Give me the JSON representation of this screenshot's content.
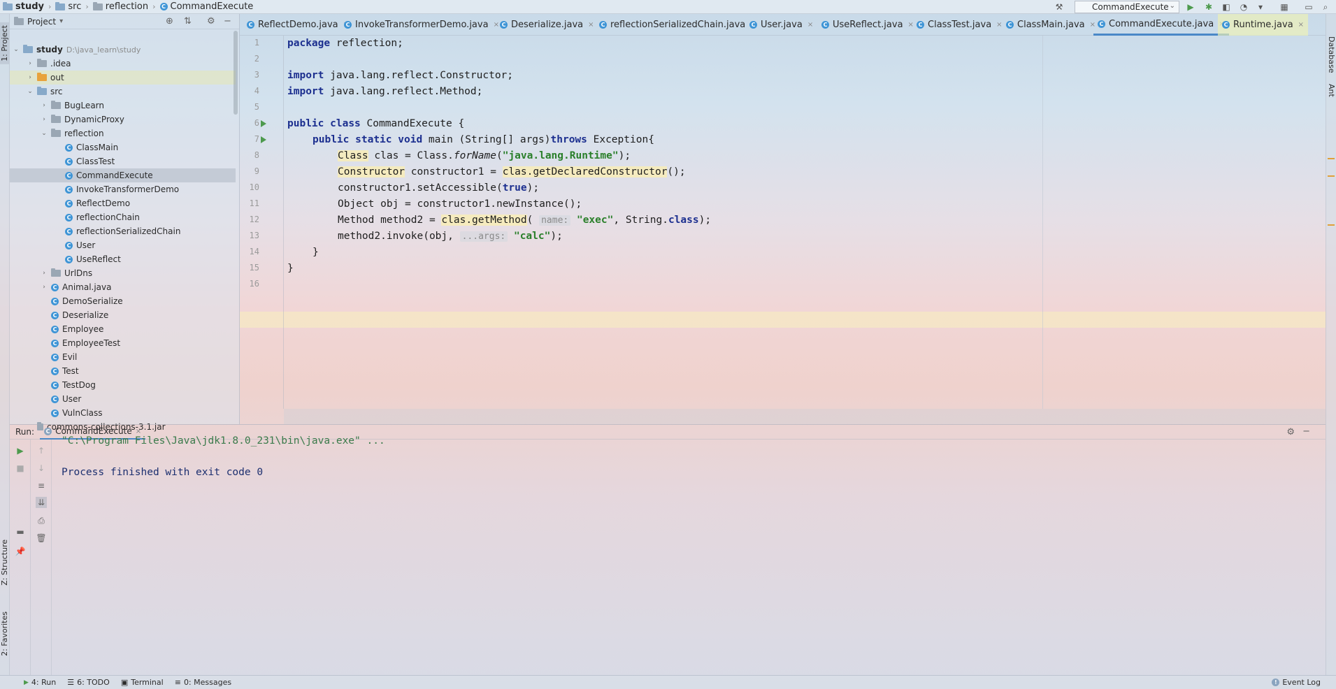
{
  "navbar": {
    "crumbs": [
      "study",
      "src",
      "reflection",
      "CommandExecute"
    ],
    "run_config": "CommandExecute"
  },
  "left_stripe": {
    "tabs": [
      "1: Project",
      "Z: Structure",
      "2: Favorites"
    ]
  },
  "project": {
    "header": "Project",
    "tree": [
      {
        "label": "study",
        "extra": "D:\\java_learn\\study",
        "depth": 0,
        "type": "module",
        "arrow": "down"
      },
      {
        "label": ".idea",
        "depth": 1,
        "type": "folder",
        "arrow": "right"
      },
      {
        "label": "out",
        "depth": 1,
        "type": "folder-orange",
        "arrow": "right",
        "highlight": true
      },
      {
        "label": "src",
        "depth": 1,
        "type": "folder-blue",
        "arrow": "down"
      },
      {
        "label": "BugLearn",
        "depth": 2,
        "type": "folder",
        "arrow": "right"
      },
      {
        "label": "DynamicProxy",
        "depth": 2,
        "type": "folder",
        "arrow": "right"
      },
      {
        "label": "reflection",
        "depth": 2,
        "type": "folder",
        "arrow": "down"
      },
      {
        "label": "ClassMain",
        "depth": 3,
        "type": "class"
      },
      {
        "label": "ClassTest",
        "depth": 3,
        "type": "class"
      },
      {
        "label": "CommandExecute",
        "depth": 3,
        "type": "class",
        "selected": true
      },
      {
        "label": "InvokeTransformerDemo",
        "depth": 3,
        "type": "class"
      },
      {
        "label": "ReflectDemo",
        "depth": 3,
        "type": "class"
      },
      {
        "label": "reflectionChain",
        "depth": 3,
        "type": "class"
      },
      {
        "label": "reflectionSerializedChain",
        "depth": 3,
        "type": "class"
      },
      {
        "label": "User",
        "depth": 3,
        "type": "class"
      },
      {
        "label": "UseReflect",
        "depth": 3,
        "type": "class"
      },
      {
        "label": "UrlDns",
        "depth": 2,
        "type": "folder",
        "arrow": "right"
      },
      {
        "label": "Animal.java",
        "depth": 2,
        "type": "class",
        "arrow": "right"
      },
      {
        "label": "DemoSerialize",
        "depth": 2,
        "type": "class"
      },
      {
        "label": "Deserialize",
        "depth": 2,
        "type": "class"
      },
      {
        "label": "Employee",
        "depth": 2,
        "type": "class"
      },
      {
        "label": "EmployeeTest",
        "depth": 2,
        "type": "class"
      },
      {
        "label": "Evil",
        "depth": 2,
        "type": "class"
      },
      {
        "label": "Test",
        "depth": 2,
        "type": "class"
      },
      {
        "label": "TestDog",
        "depth": 2,
        "type": "class"
      },
      {
        "label": "User",
        "depth": 2,
        "type": "class"
      },
      {
        "label": "VulnClass",
        "depth": 2,
        "type": "class"
      },
      {
        "label": "commons-collections-3.1.jar",
        "depth": 1,
        "type": "jar"
      }
    ]
  },
  "tabs": [
    {
      "label": "ReflectDemo.java"
    },
    {
      "label": "InvokeTransformerDemo.java"
    },
    {
      "label": "Deserialize.java"
    },
    {
      "label": "reflectionSerializedChain.java"
    },
    {
      "label": "User.java"
    },
    {
      "label": "UseReflect.java"
    },
    {
      "label": "ClassTest.java"
    },
    {
      "label": "ClassMain.java"
    },
    {
      "label": "CommandExecute.java",
      "active": true
    },
    {
      "label": "Runtime.java",
      "highlight": true
    }
  ],
  "editor": {
    "line_numbers": [
      "1",
      "2",
      "3",
      "4",
      "5",
      "6",
      "7",
      "8",
      "9",
      "10",
      "11",
      "12",
      "13",
      "14",
      "15",
      "16"
    ],
    "tokens": {
      "package": "package",
      "pkg_name": " reflection;",
      "import": "import",
      "imp1": " java.lang.reflect.Constructor;",
      "imp2": " java.lang.reflect.Method;",
      "public": "public",
      "class": "class",
      "class_decl": " CommandExecute {",
      "static": "static",
      "void": "void",
      "main_sig": " main (String[] args)",
      "throws": "throws",
      "exc": " Exception{",
      "l8_type": "Class",
      "l8_a": " clas = Class.",
      "l8_forname": "forName",
      "l8_b": "(",
      "l8_str": "\"java.lang.Runtime\"",
      "l8_c": ");",
      "l9_type": "Constructor",
      "l9_a": " constructor1 = ",
      "l9_call": "clas.getDeclaredConstructor",
      "l9_b": "();",
      "l10_a": "constructor1.setAccessible(",
      "l10_true": "true",
      "l10_b": ");",
      "l11": "Object obj = constructor1.newInstance();",
      "l12_a": "Method method2 = ",
      "l12_call": "clas.getMethod",
      "l12_b": "( ",
      "l12_hint": "name:",
      "l12_str": "\"exec\"",
      "l12_c": ", String.",
      "l12_class": "class",
      "l12_d": ");",
      "l13_a": "method2.invoke(obj, ",
      "l13_hint": "...args:",
      "l13_str": "\"calc\"",
      "l13_b": ");",
      "close_inner": "}",
      "close_outer": "}"
    }
  },
  "right_stripe": {
    "tabs": [
      "Database",
      "Ant"
    ]
  },
  "run": {
    "label": "Run:",
    "tab": "CommandExecute",
    "console": [
      {
        "text": "\"C:\\Program Files\\Java\\jdk1.8.0_231\\bin\\java.exe\" ...",
        "color": "#3a7a4a"
      },
      {
        "text": "Process finished with exit code 0",
        "color": "#1c2f6f"
      }
    ]
  },
  "status": {
    "tabs": [
      {
        "label": "4: Run",
        "icon": "play-icon",
        "active": true
      },
      {
        "label": "6: TODO",
        "icon": "list-icon"
      },
      {
        "label": "Terminal",
        "icon": "terminal-icon"
      },
      {
        "label": "0: Messages",
        "icon": "messages-icon"
      }
    ],
    "event_log": "Event Log"
  }
}
